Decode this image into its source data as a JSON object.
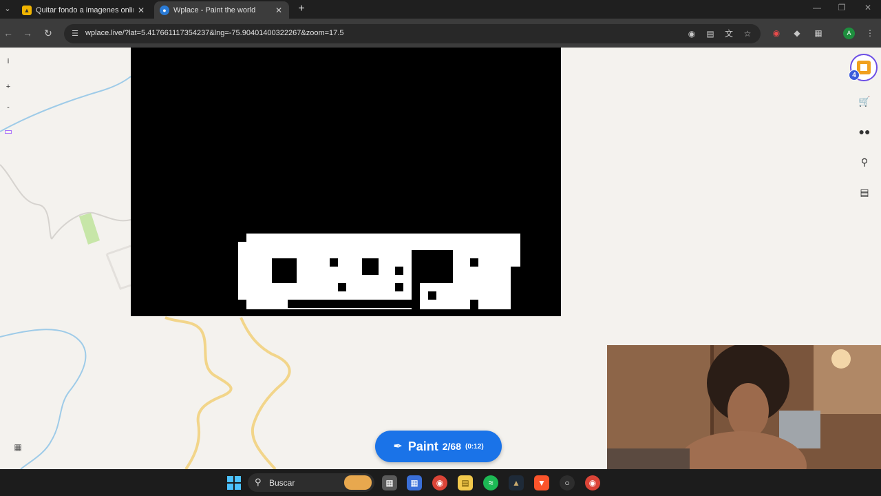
{
  "browser": {
    "tabs": [
      {
        "title": "Quitar fondo a imagenes online",
        "icon": "remove-bg-favicon",
        "active": false
      },
      {
        "title": "Wplace - Paint the world",
        "icon": "globe-favicon",
        "active": true
      }
    ],
    "new_tab_label": "+",
    "url": "wplace.live/?lat=5.417661117354237&lng=-75.90401400322267&zoom=17.5",
    "profile_initial": "A"
  },
  "map": {
    "left_controls": {
      "info": "i",
      "zoom_in": "+",
      "zoom_out": "-"
    },
    "level_badge": "4",
    "paint_button": {
      "label": "Paint",
      "charges": "2/68",
      "timer": "(0:12)"
    }
  },
  "taskbar": {
    "search_label": "Buscar"
  },
  "colors": {
    "tab_bar": "#1f1f1f",
    "toolbar": "#3c3c3c",
    "map_bg": "#f4f2ee",
    "road": "#f2d58a",
    "river": "#9ecbe8",
    "paint_button": "#1a73e8",
    "pixel_art_dark": "#000000",
    "pixel_art_light": "#ffffff"
  }
}
